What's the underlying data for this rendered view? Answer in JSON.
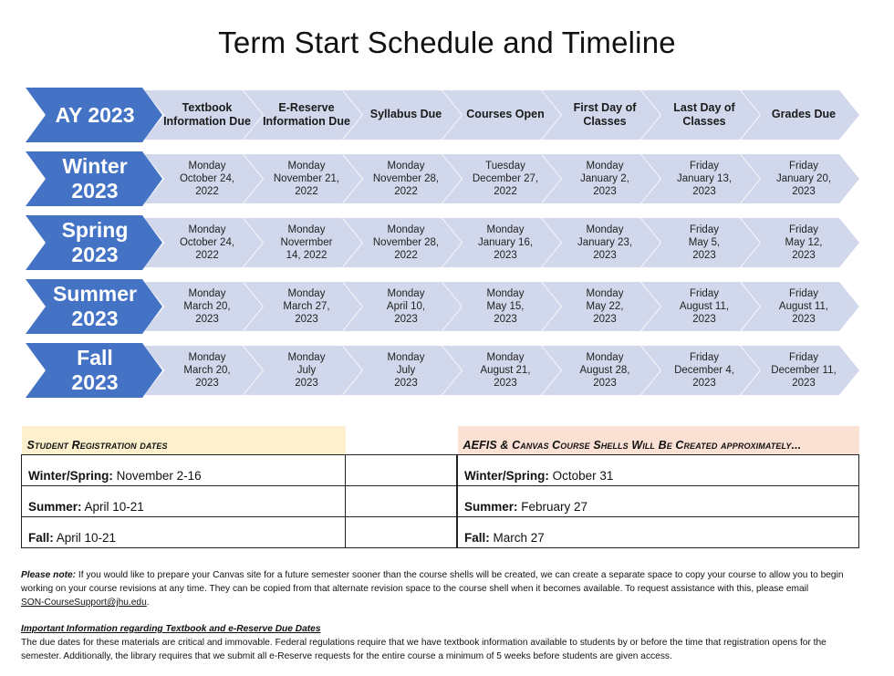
{
  "title": "Term Start Schedule and Timeline",
  "colors": {
    "term_chevron": "#4472c4",
    "step_chevron": "#d2d8eb",
    "registration_header": "#fdf1cd",
    "shells_header": "#fbe1d4"
  },
  "timeline": {
    "header": {
      "label": "AY 2023",
      "columns": [
        "Textbook Information Due",
        "E-Reserve Information Due",
        "Syllabus Due",
        "Courses Open",
        "First Day of Classes",
        "Last Day of Classes",
        "Grades Due"
      ]
    },
    "terms": [
      {
        "label_line1": "Winter",
        "label_line2": "2023",
        "dates": [
          {
            "day": "Monday",
            "date": "October 24,",
            "year": "2022"
          },
          {
            "day": "Monday",
            "date": "November 21,",
            "year": "2022"
          },
          {
            "day": "Monday",
            "date": "November 28,",
            "year": "2022"
          },
          {
            "day": "Tuesday",
            "date": "December 27,",
            "year": "2022"
          },
          {
            "day": "Monday",
            "date": "January 2,",
            "year": "2023"
          },
          {
            "day": "Friday",
            "date": "January 13,",
            "year": "2023"
          },
          {
            "day": "Friday",
            "date": "January 20,",
            "year": "2023"
          }
        ]
      },
      {
        "label_line1": "Spring",
        "label_line2": "2023",
        "dates": [
          {
            "day": "Monday",
            "date": "October 24,",
            "year": "2022"
          },
          {
            "day": "Monday",
            "date": "Novermber",
            "year": "14, 2022"
          },
          {
            "day": "Monday",
            "date": "November 28,",
            "year": "2022"
          },
          {
            "day": "Monday",
            "date": "January 16,",
            "year": "2023"
          },
          {
            "day": "Monday",
            "date": "January 23,",
            "year": "2023"
          },
          {
            "day": "Friday",
            "date": "May 5,",
            "year": "2023"
          },
          {
            "day": "Friday",
            "date": "May 12,",
            "year": "2023"
          }
        ]
      },
      {
        "label_line1": "Summer",
        "label_line2": "2023",
        "dates": [
          {
            "day": "Monday",
            "date": "March 20,",
            "year": "2023"
          },
          {
            "day": "Monday",
            "date": "March 27,",
            "year": "2023"
          },
          {
            "day": "Monday",
            "date": "April 10,",
            "year": "2023"
          },
          {
            "day": "Monday",
            "date": "May 15,",
            "year": "2023"
          },
          {
            "day": "Monday",
            "date": "May 22,",
            "year": "2023"
          },
          {
            "day": "Friday",
            "date": "August 11,",
            "year": "2023"
          },
          {
            "day": "Friday",
            "date": "August 11,",
            "year": "2023"
          }
        ]
      },
      {
        "label_line1": "Fall",
        "label_line2": "2023",
        "dates": [
          {
            "day": "Monday",
            "date": "March 20,",
            "year": "2023"
          },
          {
            "day": "Monday",
            "date": "July",
            "year": "2023"
          },
          {
            "day": "Monday",
            "date": "July",
            "year": "2023"
          },
          {
            "day": "Monday",
            "date": "August 21,",
            "year": "2023"
          },
          {
            "day": "Monday",
            "date": "August 28,",
            "year": "2023"
          },
          {
            "day": "Friday",
            "date": "December 4,",
            "year": "2023"
          },
          {
            "day": "Friday",
            "date": "December 11,",
            "year": "2023"
          }
        ]
      }
    ]
  },
  "registration": {
    "header": "Student Registration dates",
    "rows": [
      {
        "term": "Winter/Spring:",
        "value": " November 2-16"
      },
      {
        "term": "Summer:",
        "value": " April 10-21"
      },
      {
        "term": "Fall:",
        "value": " April 10-21"
      }
    ]
  },
  "shells": {
    "header": "AEFIS & Canvas Course Shells Will Be Created approximately...",
    "rows": [
      {
        "term": "Winter/Spring:",
        "value": " October 31"
      },
      {
        "term": "Summer:",
        "value": " February 27"
      },
      {
        "term": "Fall:",
        "value": " March 27"
      }
    ]
  },
  "notes": {
    "please_note_label": "Please note:",
    "please_note_text": " If you would like to prepare your Canvas site for a future semester sooner than the course shells will be created, we can create a separate space to copy your course to allow you to begin working on your course revisions at any time. They can be copied from that alternate revision space to the course shell when it becomes available. To request assistance with this, please email ",
    "email": "SON-CourseSupport@jhu.edu",
    "email_suffix": ".",
    "important_heading": "Important Information regarding Textbook and e-Reserve Due Dates",
    "important_text": "The due dates for these materials are critical and immovable. Federal regulations require that we have textbook information available to students by or before the time that registration opens for the semester. Additionally, the library requires that we submit all e-Reserve requests for the entire course a minimum of 5 weeks before students are given access."
  }
}
